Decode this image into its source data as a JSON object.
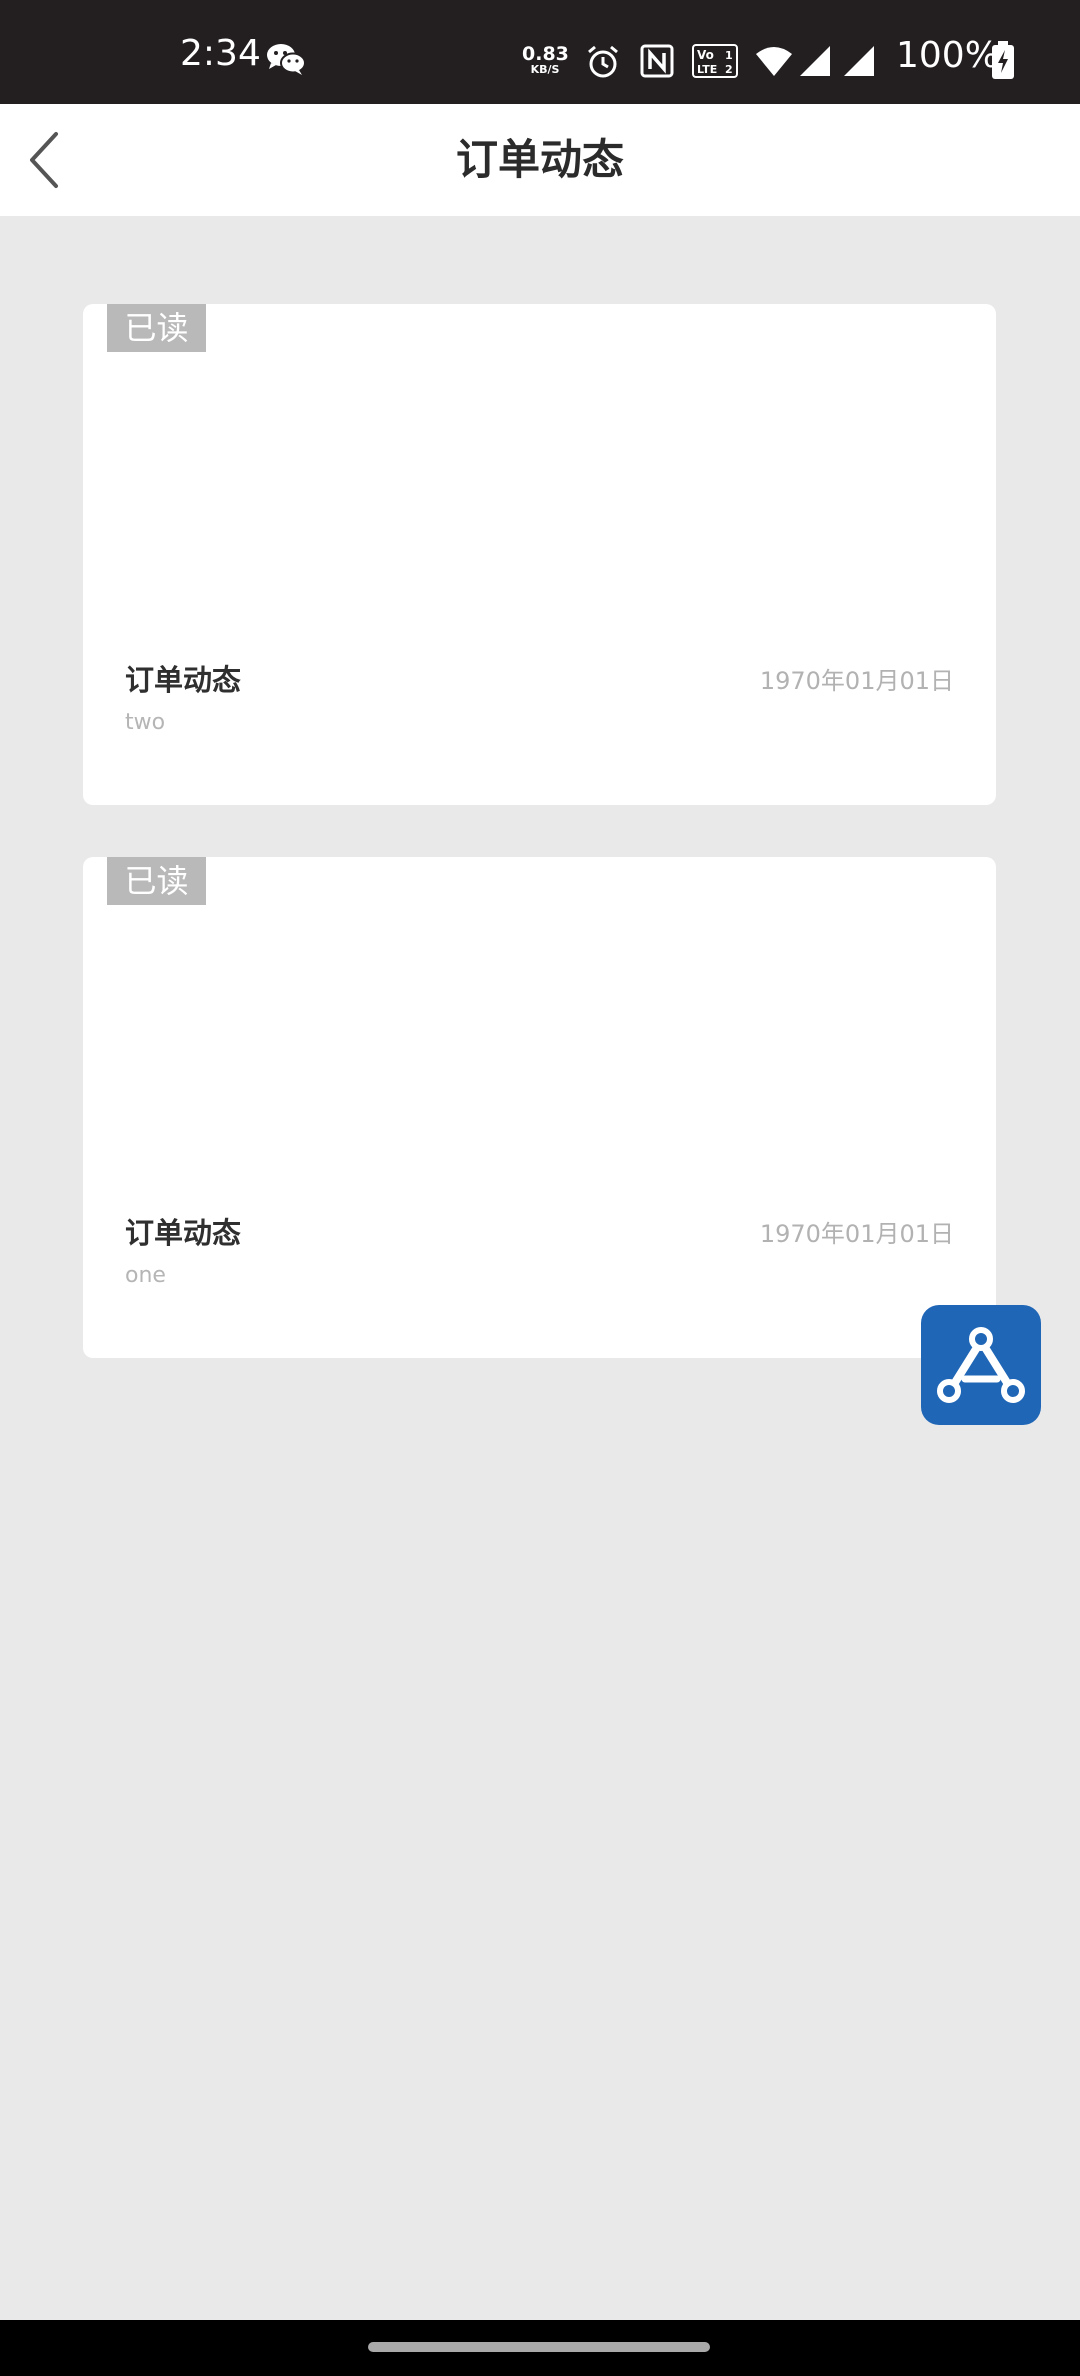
{
  "status_bar": {
    "time": "2:34",
    "network_speed_value": "0.83",
    "network_speed_unit": "KB/S",
    "battery_percent": "100%",
    "icons": [
      "wechat-icon",
      "alarm-icon",
      "nfc-icon",
      "volte-icon",
      "wifi-icon",
      "signal-icon",
      "signal-icon",
      "battery-charging-icon"
    ]
  },
  "header": {
    "title": "订单动态",
    "back_icon": "chevron-left-icon"
  },
  "cards": [
    {
      "badge": "已读",
      "title": "订单动态",
      "subtitle": "two",
      "date": "1970年01月01日"
    },
    {
      "badge": "已读",
      "title": "订单动态",
      "subtitle": "one",
      "date": "1970年01月01日"
    }
  ],
  "fab": {
    "icon": "app-store-icon",
    "color": "#1f66b6"
  },
  "colors": {
    "status_bar": "#231f20",
    "background": "#e9e9ea",
    "badge": "#b9b9b9",
    "accent": "#1f66b6"
  }
}
